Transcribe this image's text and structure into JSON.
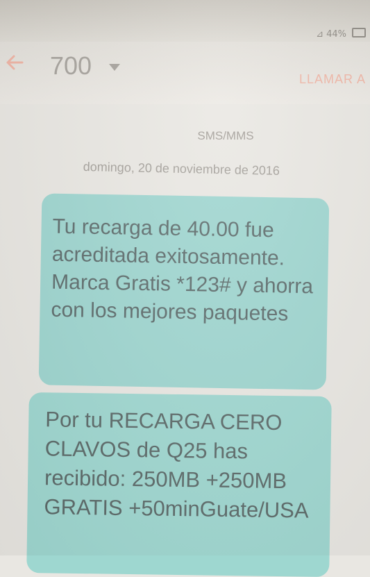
{
  "status_bar": {
    "text": "⊿ 44%"
  },
  "header": {
    "contact": "700",
    "call_label": "LLAMAR A"
  },
  "thread": {
    "channel": "SMS/MMS",
    "date": "domingo, 20 de noviembre de 2016",
    "messages": [
      {
        "text": "Tu recarga de 40.00 fue acreditada exitosamente. Marca Gratis *123# y ahorra con los mejores paquetes"
      },
      {
        "text": "Por tu RECARGA CERO CLAVOS de Q25 has recibido: 250MB +250MB GRATIS +50minGuate/USA"
      }
    ]
  },
  "colors": {
    "bubble": "#9dd5cf",
    "accent": "#efb3a3",
    "background": "#e9e7e2"
  }
}
